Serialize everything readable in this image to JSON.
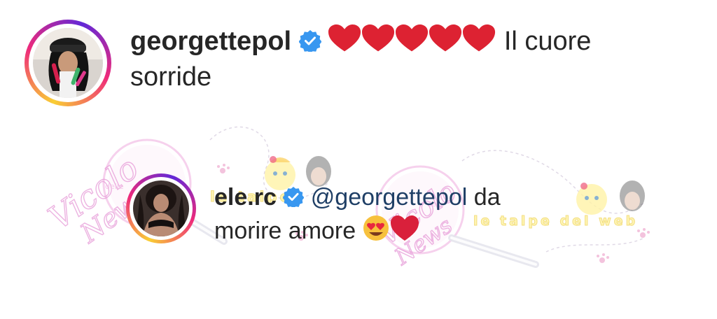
{
  "comments": [
    {
      "username": "georgettepol",
      "verified": true,
      "emoji": [
        "red-heart",
        "red-heart",
        "red-heart",
        "red-heart",
        "red-heart"
      ],
      "text_before_wrap": "Il cuore",
      "text_after_wrap": "sorride",
      "avatar": "profile-photo-georgettepol"
    },
    {
      "username": "ele.rc",
      "verified": true,
      "mention": "@georgettepol",
      "text_line1_tail": "da",
      "text_line2": "morire amore",
      "emoji": [
        "heart-eyes-face",
        "red-heart"
      ],
      "avatar": "profile-photo-ele-rc"
    }
  ],
  "watermark": {
    "script_text": "Vicolo",
    "script_text_2": "News",
    "small_text": "delle",
    "caption": "le talpe del web"
  },
  "colors": {
    "verified_blue": "#3897f0",
    "heart_red": "#e0245e",
    "text": "#262626",
    "watermark_pink": "#e69ad7"
  }
}
